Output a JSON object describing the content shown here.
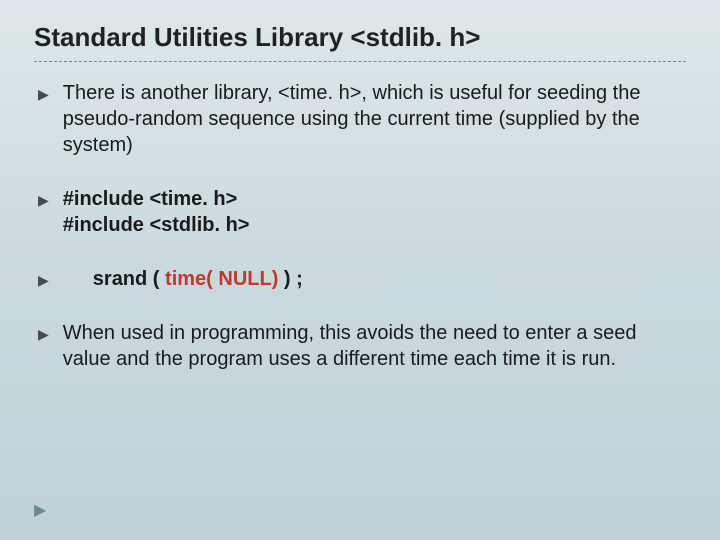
{
  "title": "Standard Utilities Library <stdlib. h>",
  "bullets": {
    "b0": "There is another library, <time. h>, which is useful for seeding the pseudo-random sequence using the current time (supplied by the system)",
    "b1_line1": "#include <time. h>",
    "b1_line2": "#include <stdlib. h>",
    "b2_prefix": "srand ( ",
    "b2_red": "time( NULL)",
    "b2_suffix": " ) ;",
    "b3": "When used in programming, this avoids the need to enter a seed value and the program uses a different time each time it is run."
  }
}
